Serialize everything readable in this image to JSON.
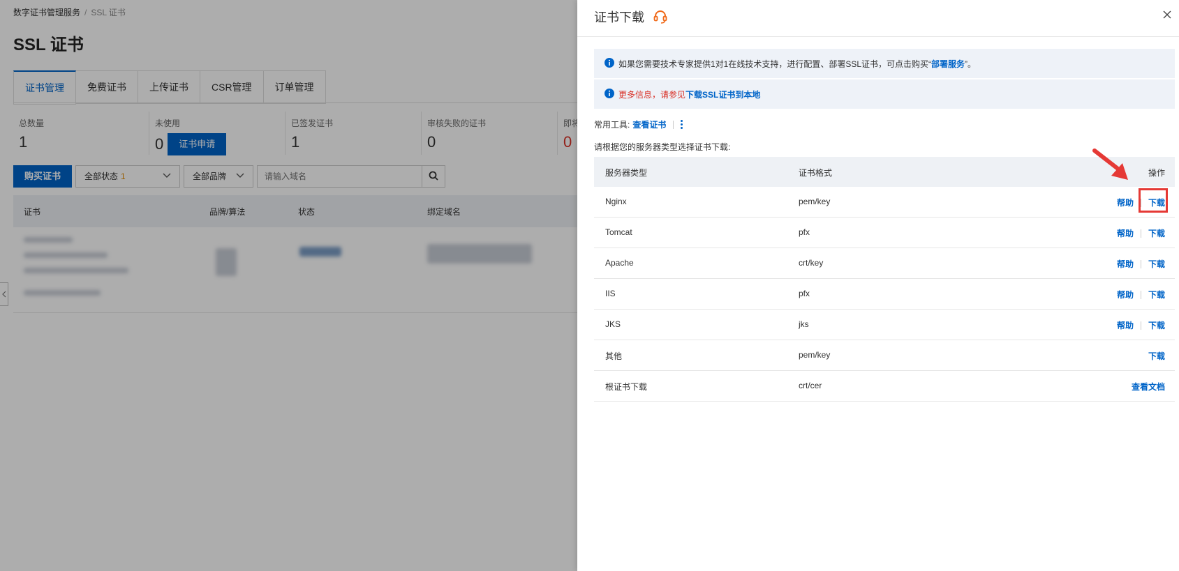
{
  "background": {
    "breadcrumb": {
      "root": "数字证书管理服务",
      "separator": "/",
      "current": "SSL 证书"
    },
    "page_title": "SSL 证书",
    "tabs": [
      {
        "label": "证书管理"
      },
      {
        "label": "免费证书"
      },
      {
        "label": "上传证书"
      },
      {
        "label": "CSR管理"
      },
      {
        "label": "订单管理"
      }
    ],
    "stats": [
      {
        "label": "总数量",
        "value": "1"
      },
      {
        "label": "未使用",
        "value": "0",
        "button": "证书申请"
      },
      {
        "label": "已签发证书",
        "value": "1"
      },
      {
        "label": "审核失败的证书",
        "value": "0"
      },
      {
        "label": "即将过期的",
        "value": "0"
      }
    ],
    "toolbar": {
      "buy_button": "购买证书",
      "status_filter": "全部状态",
      "status_count": "1",
      "brand_filter": "全部品牌",
      "search_placeholder": "请输入域名"
    },
    "table_headers": [
      "证书",
      "品牌/算法",
      "状态",
      "绑定域名"
    ]
  },
  "drawer": {
    "title": "证书下载",
    "notice1": {
      "text": "如果您需要技术专家提供1对1在线技术支持，进行配置、部署SSL证书，可点击购买“",
      "link": "部署服务",
      "suffix": "”。"
    },
    "notice2": {
      "text": "更多信息，请参见",
      "link": "下载SSL证书到本地"
    },
    "tools_label": "常用工具:",
    "tools_link": "查看证书",
    "hint": "请根据您的服务器类型选择证书下载:",
    "table": {
      "headers": {
        "server_type": "服务器类型",
        "format": "证书格式",
        "action": "操作"
      },
      "help_label": "帮助",
      "download_label": "下载",
      "rows": [
        {
          "server": "Nginx",
          "format": "pem/key",
          "action": "下载"
        },
        {
          "server": "Tomcat",
          "format": "pfx",
          "action": "下载"
        },
        {
          "server": "Apache",
          "format": "crt/key",
          "action": "下载"
        },
        {
          "server": "IIS",
          "format": "pfx",
          "action": "下载"
        },
        {
          "server": "JKS",
          "format": "jks",
          "action": "下载"
        },
        {
          "server": "其他",
          "format": "pem/key",
          "action": "下载"
        },
        {
          "server": "根证书下载",
          "format": "crt/cer",
          "action": "查看文档"
        }
      ]
    }
  },
  "colors": {
    "accent": "#0064c8",
    "alert": "#d93026",
    "highlight": "#e53935"
  }
}
